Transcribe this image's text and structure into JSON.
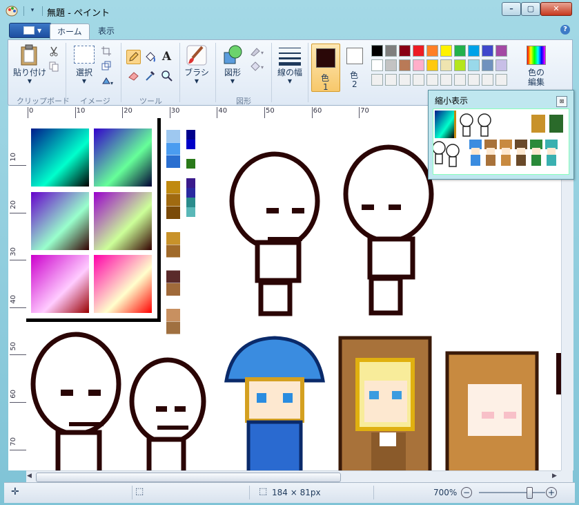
{
  "window": {
    "title": "無題 - ペイント",
    "qa_dropdown": "▾",
    "min": "–",
    "max": "▢",
    "close": "✕"
  },
  "tabs": {
    "home": "ホーム",
    "view": "表示",
    "help": "?"
  },
  "ribbon": {
    "paste_label": "貼り付け",
    "clipboard_group": "クリップボード",
    "select_label": "選択",
    "image_group": "イメージ",
    "tools_group": "ツール",
    "text_tool": "A",
    "brush_label": "ブラシ",
    "shapes_label": "図形",
    "shapes_group": "図形",
    "line_width_label": "線の幅",
    "color1_label": "色",
    "color1_num": "1",
    "color2_label": "色",
    "color2_num": "2",
    "edit_colors_label": "色の\n編集",
    "palette": [
      [
        "#000000",
        "#7f7f7f",
        "#880015",
        "#ed1c24",
        "#ff7f27",
        "#fff200",
        "#22b14c",
        "#00a2e8",
        "#3f48cc",
        "#a349a4"
      ],
      [
        "#ffffff",
        "#c3c3c3",
        "#b97a57",
        "#ffaec9",
        "#ffc90e",
        "#efe4b0",
        "#b5e61d",
        "#99d9ea",
        "#7092be",
        "#c8bfe7"
      ],
      [
        "#f0f0f0",
        "#f0f0f0",
        "#f0f0f0",
        "#f0f0f0",
        "#f0f0f0",
        "#f0f0f0",
        "#f0f0f0",
        "#f0f0f0",
        "#f0f0f0",
        "#f0f0f0"
      ]
    ]
  },
  "ruler": {
    "top_ticks": [
      "0",
      "10",
      "20",
      "30",
      "40",
      "50",
      "60",
      "70"
    ],
    "left_ticks": [
      "10",
      "20",
      "30",
      "40",
      "50",
      "60",
      "70"
    ]
  },
  "thumbnail": {
    "title": "縮小表示",
    "close": "⊠"
  },
  "status": {
    "size": "184 × 81px",
    "zoom": "700%",
    "zoom_out": "−",
    "zoom_in": "+"
  },
  "zoom_slider": {
    "value": 0.75
  }
}
